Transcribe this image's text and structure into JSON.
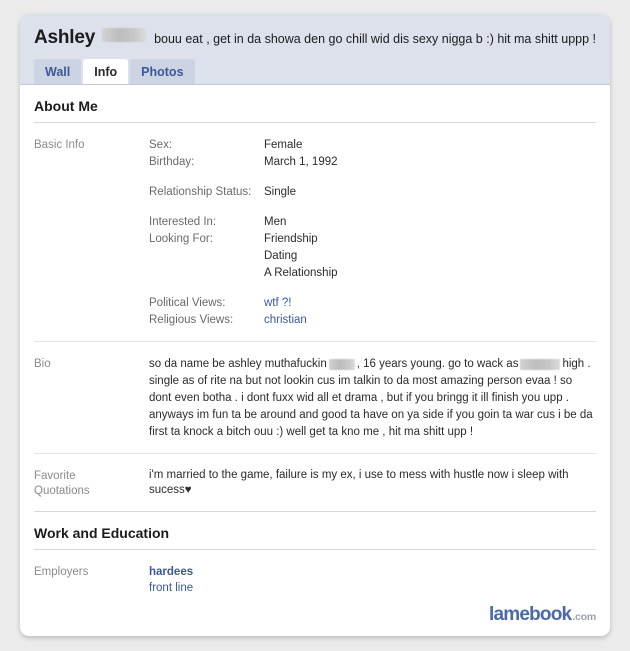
{
  "header": {
    "profile_name": "Ashley",
    "status_text": "bouu eat , get in da showa den go chill wid dis sexy nigga b :) hit ma shitt uppp !",
    "tabs": [
      {
        "label": "Wall",
        "active": false
      },
      {
        "label": "Info",
        "active": true
      },
      {
        "label": "Photos",
        "active": false
      }
    ]
  },
  "sections": {
    "about_me": {
      "title": "About Me",
      "basic_info": {
        "label": "Basic Info",
        "fields": [
          {
            "key": "Sex:",
            "value": "Female"
          },
          {
            "key": "Birthday:",
            "value": "March 1, 1992"
          },
          {
            "key": "Relationship Status:",
            "value": "Single"
          },
          {
            "key": "Interested In:",
            "value": "Men"
          }
        ],
        "looking_for_key": "Looking For:",
        "looking_for_values": [
          "Friendship",
          "Dating",
          "A Relationship"
        ],
        "political_key": "Political Views:",
        "political_value": "wtf ?!",
        "religious_key": "Religious Views:",
        "religious_value": "christian"
      },
      "bio": {
        "label": "Bio",
        "text_part_1": "so da name be ashley muthafuckin",
        "text_part_2": ", 16 years young. go to wack as",
        "text_part_3": "high . single as of rite na but not lookin cus im talkin to da most amazing person evaa ! so dont even botha . i dont fuxx wid all et drama , but if you bringg it ill finish you upp . anyways im fun ta be around and good ta have on ya side if you goin ta war cus i be da first ta knock a bitch ouu :) well get ta kno me , hit ma shitt upp !"
      },
      "favorite_quotations": {
        "label_line_1": "Favorite",
        "label_line_2": "Quotations",
        "text": "i'm married to the game, failure is my ex, i use to mess with hustle now i sleep with sucess♥"
      }
    },
    "work_and_education": {
      "title": "Work and Education",
      "employers": {
        "label": "Employers",
        "name": "hardees",
        "role": "front line"
      }
    }
  },
  "watermark": {
    "main": "lamebook",
    "tld": ".com"
  },
  "colors": {
    "link_blue": "#3b5998",
    "header_band": "#dde1ec",
    "tab_inactive": "#ccd3e3",
    "label_gray": "#8b8b8b",
    "watermark_blue": "#4a69ad"
  }
}
